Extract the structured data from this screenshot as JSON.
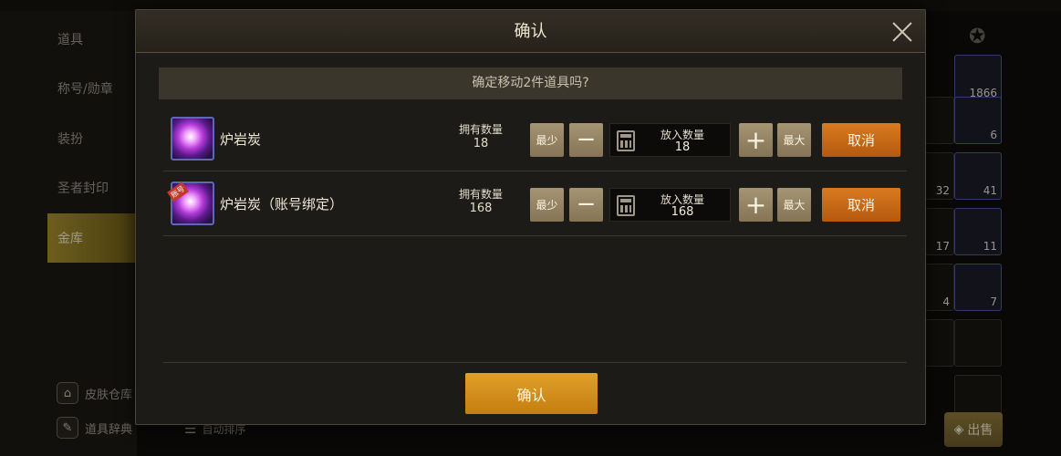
{
  "sidebar": {
    "items": [
      {
        "label": "道具"
      },
      {
        "label": "称号/勋章"
      },
      {
        "label": "装扮"
      },
      {
        "label": "圣者封印"
      },
      {
        "label": "金库"
      }
    ],
    "bottom_links": [
      {
        "label": "皮肤仓库"
      },
      {
        "label": "道具辞典"
      }
    ]
  },
  "toolbar": {
    "auto_sort_label": "自动排序",
    "sell_label": "出售"
  },
  "background_slots": [
    {
      "count": "1866"
    },
    {
      "count": "6"
    },
    {
      "count": "32"
    },
    {
      "count": "41"
    },
    {
      "count": "17"
    },
    {
      "count": "11"
    },
    {
      "count": "4"
    },
    {
      "count": "7"
    }
  ],
  "dialog": {
    "title": "确认",
    "question": "确定移动2件道具吗?",
    "confirm_label": "确认",
    "rows": [
      {
        "name": "炉岩炭",
        "own_label": "拥有数量",
        "own_value": "18",
        "min_label": "最少",
        "minus_symbol": "−",
        "qty_label": "放入数量",
        "qty_value": "18",
        "plus_symbol": "+",
        "max_label": "最大",
        "cancel_label": "取消"
      },
      {
        "name": "炉岩炭（账号绑定）",
        "own_label": "拥有数量",
        "own_value": "168",
        "min_label": "最少",
        "minus_symbol": "−",
        "qty_label": "放入数量",
        "qty_value": "168",
        "plus_symbol": "+",
        "max_label": "最大",
        "cancel_label": "取消"
      }
    ]
  },
  "colors": {
    "accent_orange": "#c96a16",
    "confirm_gold": "#d8921e",
    "active_tab": "#a8912e",
    "icon_border": "#5e67b8"
  }
}
